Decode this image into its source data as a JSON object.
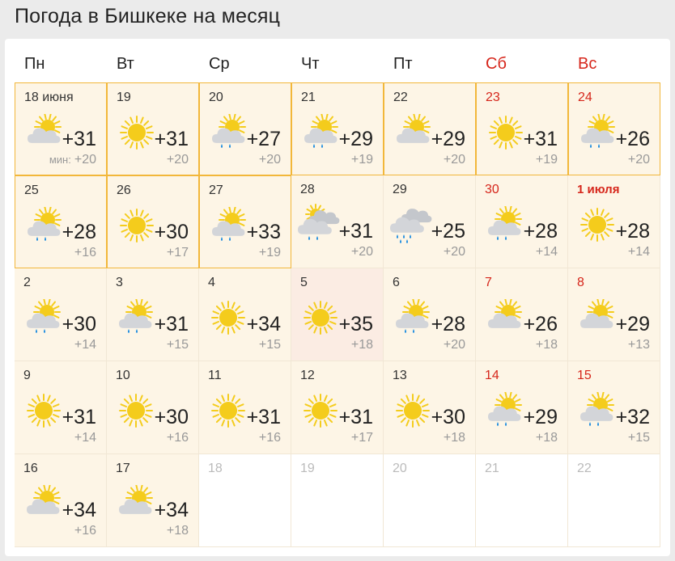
{
  "title": "Погода в Бишкеке на месяц",
  "min_label": "мин:",
  "weekdays": [
    {
      "label": "Пн",
      "weekend": false
    },
    {
      "label": "Вт",
      "weekend": false
    },
    {
      "label": "Ср",
      "weekend": false
    },
    {
      "label": "Чт",
      "weekend": false
    },
    {
      "label": "Пт",
      "weekend": false
    },
    {
      "label": "Сб",
      "weekend": true
    },
    {
      "label": "Вс",
      "weekend": true
    }
  ],
  "colors": {
    "weekend": "#d6261b",
    "highlight_border": "#f2b73a",
    "past_bg": "#fdf5e6",
    "hot_bg": "#fbece3"
  },
  "days": [
    {
      "label": "18 июня",
      "icon": "partly-cloudy-icon",
      "max": "+31",
      "min": "+20",
      "weekend": false,
      "highlight": true,
      "state": "past",
      "show_min_word": true
    },
    {
      "label": "19",
      "icon": "sun-icon",
      "max": "+31",
      "min": "+20",
      "weekend": false,
      "highlight": true,
      "state": "past"
    },
    {
      "label": "20",
      "icon": "partly-cloudy-rain-icon",
      "max": "+27",
      "min": "+20",
      "weekend": false,
      "highlight": true,
      "state": "past"
    },
    {
      "label": "21",
      "icon": "partly-cloudy-rain-icon",
      "max": "+29",
      "min": "+19",
      "weekend": false,
      "highlight": true,
      "state": "past"
    },
    {
      "label": "22",
      "icon": "partly-cloudy-icon",
      "max": "+29",
      "min": "+20",
      "weekend": false,
      "highlight": true,
      "state": "past"
    },
    {
      "label": "23",
      "icon": "sun-icon",
      "max": "+31",
      "min": "+19",
      "weekend": true,
      "highlight": true,
      "state": "past"
    },
    {
      "label": "24",
      "icon": "partly-cloudy-rain-icon",
      "max": "+26",
      "min": "+20",
      "weekend": true,
      "highlight": true,
      "state": "past"
    },
    {
      "label": "25",
      "icon": "partly-cloudy-rain-icon",
      "max": "+28",
      "min": "+16",
      "weekend": false,
      "highlight": true,
      "state": "past"
    },
    {
      "label": "26",
      "icon": "sun-icon",
      "max": "+30",
      "min": "+17",
      "weekend": false,
      "highlight": true,
      "state": "past"
    },
    {
      "label": "27",
      "icon": "partly-cloudy-rain-icon",
      "max": "+33",
      "min": "+19",
      "weekend": false,
      "highlight": true,
      "state": "past"
    },
    {
      "label": "28",
      "icon": "cloudy-sun-rain-icon",
      "max": "+31",
      "min": "+20",
      "weekend": false,
      "highlight": false,
      "state": "past"
    },
    {
      "label": "29",
      "icon": "cloudy-rain-icon",
      "max": "+25",
      "min": "+20",
      "weekend": false,
      "highlight": false,
      "state": "past"
    },
    {
      "label": "30",
      "icon": "partly-cloudy-rain-icon",
      "max": "+28",
      "min": "+14",
      "weekend": true,
      "highlight": false,
      "state": "past"
    },
    {
      "label": "1 июля",
      "icon": "sun-icon",
      "max": "+28",
      "min": "+14",
      "weekend": true,
      "highlight": false,
      "state": "past",
      "bold": true
    },
    {
      "label": "2",
      "icon": "partly-cloudy-rain-icon",
      "max": "+30",
      "min": "+14",
      "weekend": false,
      "highlight": false,
      "state": "past"
    },
    {
      "label": "3",
      "icon": "partly-cloudy-rain-icon",
      "max": "+31",
      "min": "+15",
      "weekend": false,
      "highlight": false,
      "state": "past"
    },
    {
      "label": "4",
      "icon": "sun-icon",
      "max": "+34",
      "min": "+15",
      "weekend": false,
      "highlight": false,
      "state": "past"
    },
    {
      "label": "5",
      "icon": "sun-icon",
      "max": "+35",
      "min": "+18",
      "weekend": false,
      "highlight": false,
      "state": "hot"
    },
    {
      "label": "6",
      "icon": "partly-cloudy-rain-icon",
      "max": "+28",
      "min": "+20",
      "weekend": false,
      "highlight": false,
      "state": "past"
    },
    {
      "label": "7",
      "icon": "partly-cloudy-icon",
      "max": "+26",
      "min": "+18",
      "weekend": true,
      "highlight": false,
      "state": "past"
    },
    {
      "label": "8",
      "icon": "partly-cloudy-icon",
      "max": "+29",
      "min": "+13",
      "weekend": true,
      "highlight": false,
      "state": "past"
    },
    {
      "label": "9",
      "icon": "sun-icon",
      "max": "+31",
      "min": "+14",
      "weekend": false,
      "highlight": false,
      "state": "past"
    },
    {
      "label": "10",
      "icon": "sun-icon",
      "max": "+30",
      "min": "+16",
      "weekend": false,
      "highlight": false,
      "state": "past"
    },
    {
      "label": "11",
      "icon": "sun-icon",
      "max": "+31",
      "min": "+16",
      "weekend": false,
      "highlight": false,
      "state": "past"
    },
    {
      "label": "12",
      "icon": "sun-icon",
      "max": "+31",
      "min": "+17",
      "weekend": false,
      "highlight": false,
      "state": "past"
    },
    {
      "label": "13",
      "icon": "sun-icon",
      "max": "+30",
      "min": "+18",
      "weekend": false,
      "highlight": false,
      "state": "past"
    },
    {
      "label": "14",
      "icon": "partly-cloudy-rain-icon",
      "max": "+29",
      "min": "+18",
      "weekend": true,
      "highlight": false,
      "state": "past"
    },
    {
      "label": "15",
      "icon": "partly-cloudy-rain-icon",
      "max": "+32",
      "min": "+15",
      "weekend": true,
      "highlight": false,
      "state": "past"
    },
    {
      "label": "16",
      "icon": "partly-cloudy-icon",
      "max": "+34",
      "min": "+16",
      "weekend": false,
      "highlight": false,
      "state": "past"
    },
    {
      "label": "17",
      "icon": "partly-cloudy-icon",
      "max": "+34",
      "min": "+18",
      "weekend": false,
      "highlight": false,
      "state": "past"
    },
    {
      "label": "18",
      "state": "future"
    },
    {
      "label": "19",
      "state": "future"
    },
    {
      "label": "20",
      "state": "future"
    },
    {
      "label": "21",
      "state": "future"
    },
    {
      "label": "22",
      "state": "future"
    }
  ]
}
